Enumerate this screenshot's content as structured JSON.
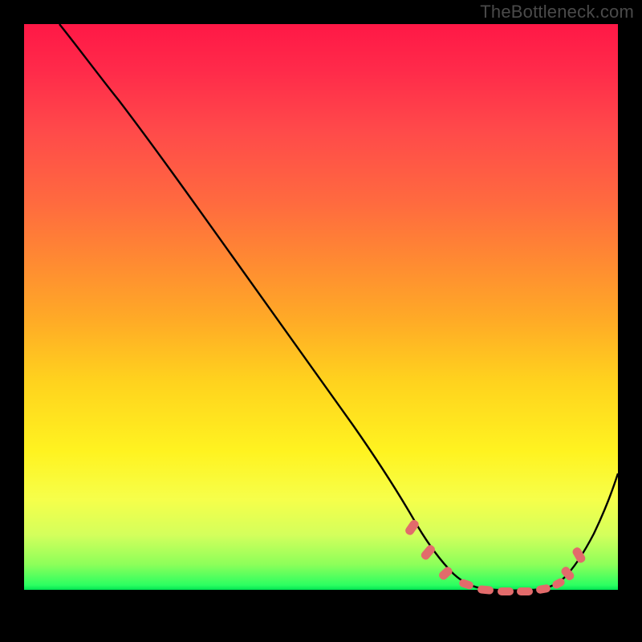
{
  "watermark": "TheBottleneck.com",
  "chart_data": {
    "type": "line",
    "title": "",
    "xlabel": "",
    "ylabel": "",
    "xlim": [
      0,
      100
    ],
    "ylim": [
      0,
      100
    ],
    "gradient_stops": [
      {
        "pos": 0,
        "color": "#ff1846"
      },
      {
        "pos": 8,
        "color": "#ff2b4a"
      },
      {
        "pos": 18,
        "color": "#ff4a4a"
      },
      {
        "pos": 30,
        "color": "#ff6a3f"
      },
      {
        "pos": 40,
        "color": "#ff8a32"
      },
      {
        "pos": 50,
        "color": "#ffab26"
      },
      {
        "pos": 60,
        "color": "#ffd21e"
      },
      {
        "pos": 72,
        "color": "#fff320"
      },
      {
        "pos": 80,
        "color": "#f6ff4a"
      },
      {
        "pos": 86,
        "color": "#d4ff5c"
      },
      {
        "pos": 91,
        "color": "#8dff5a"
      },
      {
        "pos": 94.5,
        "color": "#2bff61"
      },
      {
        "pos": 95.3,
        "color": "#00e352"
      }
    ],
    "series": [
      {
        "name": "bottleneck-curve",
        "x": [
          6,
          10,
          16,
          24,
          32,
          40,
          48,
          56,
          62,
          65,
          68,
          72,
          76,
          80,
          84,
          88,
          91,
          94,
          97,
          100
        ],
        "y": [
          100,
          96,
          89,
          79,
          69,
          59,
          49,
          39,
          30,
          22,
          15,
          9,
          5.5,
          4.8,
          4.6,
          4.9,
          6,
          10,
          17,
          26
        ]
      }
    ],
    "markers": {
      "shape": "rounded-rect",
      "color": "#e26b6b",
      "positions_x": [
        65,
        68.5,
        72,
        75,
        78,
        81,
        84,
        87,
        89.5,
        91.5,
        93
      ],
      "positions_y": [
        22,
        15,
        9,
        6.2,
        5.3,
        4.8,
        4.6,
        5.0,
        5.8,
        7.8,
        11
      ]
    }
  }
}
